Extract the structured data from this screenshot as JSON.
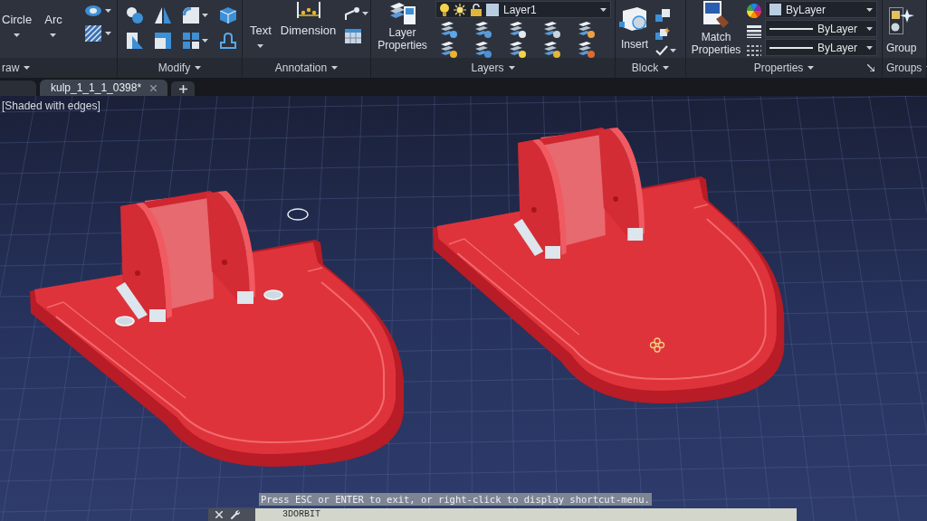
{
  "ribbon": {
    "draw": {
      "title": "raw",
      "tools": [
        "Circle",
        "Arc"
      ]
    },
    "modify": {
      "title": "Modify"
    },
    "annotation": {
      "title": "Annotation",
      "tools": [
        "Text",
        "Dimension"
      ]
    },
    "layers": {
      "title": "Layers",
      "tool": "Layer Properties",
      "current_layer": "Layer1"
    },
    "block": {
      "title": "Block",
      "tool": "Insert"
    },
    "properties": {
      "title": "Properties",
      "tool": "Match Properties",
      "color_setting": "ByLayer",
      "lineweight": "ByLayer",
      "linetype": "ByLayer"
    },
    "groups": {
      "title": "Groups",
      "tool": "Group"
    }
  },
  "file_tabs": [
    {
      "label": "kulp_1_1_1_0398*",
      "selected": true
    }
  ],
  "viewport": {
    "visual_style": "[Shaded with edges]"
  },
  "command_line": {
    "tooltip": "Press ESC or ENTER to exit, or right-click to display shortcut-menu.",
    "command": "3DORBIT"
  }
}
